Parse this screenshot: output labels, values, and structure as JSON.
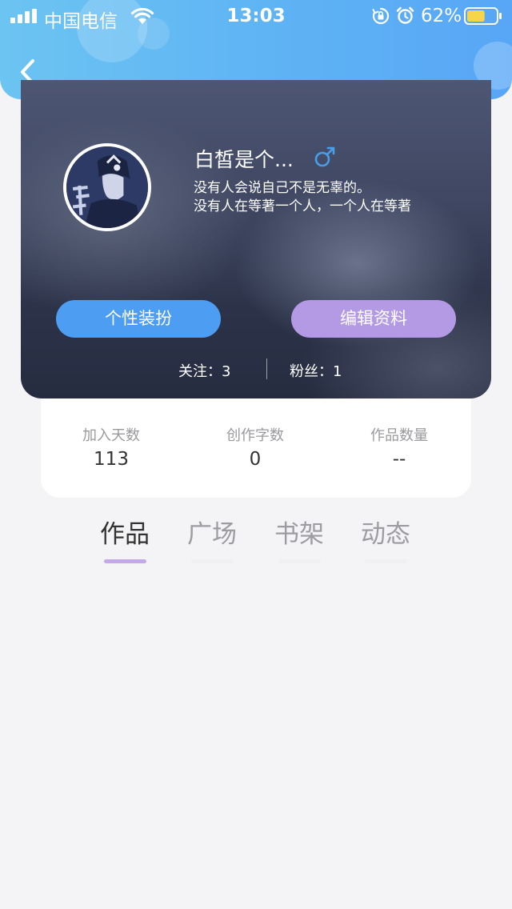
{
  "status_bar": {
    "carrier": "中国电信",
    "time": "13:03",
    "battery": "62%",
    "battery_level": 0.62
  },
  "profile": {
    "username": "白皙是个...",
    "gender_symbol": "♂",
    "bio_line1": "没有人会说自己不是无辜的。",
    "bio_line2": "没有人在等著一个人，一个人在等著",
    "dress_button": "个性装扮",
    "edit_button": "编辑资料",
    "following": "关注：3",
    "fans": "粉丝：1"
  },
  "stats": [
    {
      "label": "加入天数",
      "value": "113"
    },
    {
      "label": "创作字数",
      "value": "0"
    },
    {
      "label": "作品数量",
      "value": "--"
    }
  ],
  "tabs": [
    {
      "label": "作品",
      "active": true
    },
    {
      "label": "广场",
      "active": false
    },
    {
      "label": "书架",
      "active": false
    },
    {
      "label": "动态",
      "active": false
    }
  ],
  "colors": {
    "header_blue": "#5eb3f4",
    "dress_button": "#4d9ef2",
    "edit_button": "#b49ae4",
    "active_tab_underline": "#c4a9e8",
    "gender_icon": "#4a9ee8"
  }
}
